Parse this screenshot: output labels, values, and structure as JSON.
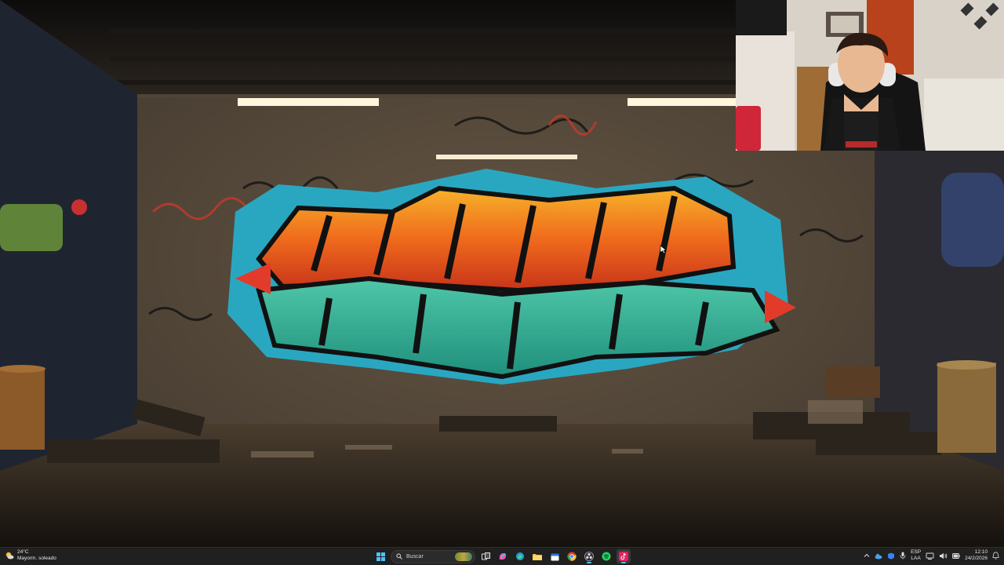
{
  "taskbar": {
    "weather": {
      "temperature": "24°C",
      "condition": "Mayorm. soleado",
      "icon": "partly-sunny-icon"
    },
    "search_label": "Buscar",
    "apps": [
      {
        "name": "start-button",
        "icon": "windows-logo-icon"
      },
      {
        "name": "task-view-button",
        "icon": "task-view-icon"
      },
      {
        "name": "copilot-button",
        "icon": "copilot-icon"
      },
      {
        "name": "edge-button",
        "icon": "edge-icon"
      },
      {
        "name": "file-explorer-button",
        "icon": "folder-icon"
      },
      {
        "name": "calendar-button",
        "icon": "calendar-icon"
      },
      {
        "name": "chrome-button",
        "icon": "chrome-icon"
      },
      {
        "name": "obs-button",
        "icon": "obs-icon"
      },
      {
        "name": "spotify-button",
        "icon": "spotify-icon"
      },
      {
        "name": "tiktok-button",
        "icon": "tiktok-icon"
      }
    ],
    "tray": {
      "language": "ESP",
      "layout": "LAA",
      "time": "12:10",
      "date": "24/2/2026"
    },
    "colors": {
      "background": "#202020",
      "active_indicator": "#4cc2ff"
    }
  }
}
